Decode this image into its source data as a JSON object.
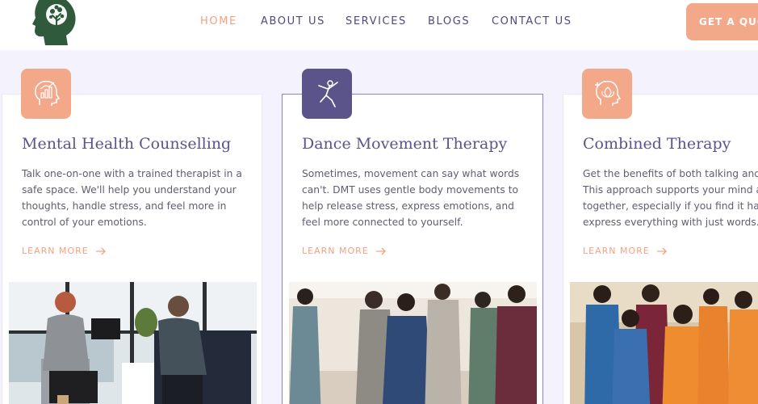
{
  "header": {
    "nav": [
      {
        "label": "HOME",
        "active": true
      },
      {
        "label": "ABOUT US",
        "active": false
      },
      {
        "label": "SERVICES",
        "active": false
      },
      {
        "label": "BLOGS",
        "active": false
      },
      {
        "label": "CONTACT US",
        "active": false
      }
    ],
    "cta_label": "GET A QUOTE"
  },
  "colors": {
    "accent_orange": "#f4a88a",
    "accent_purple": "#5b548a",
    "logo_green": "#2f5a3c",
    "page_bg": "#f4f2fd"
  },
  "cards": [
    {
      "icon": "head-chart-icon",
      "title": "Mental Health Counselling",
      "description": [
        "Talk one-on-one with a trained therapist in a",
        "safe space. We'll help you understand your",
        "thoughts, handle stress, and feel more in",
        "control of your emotions."
      ],
      "link": "LEARN MORE",
      "image": "counselling-session-photo"
    },
    {
      "icon": "dancer-icon",
      "title": "Dance Movement Therapy",
      "description": [
        "Sometimes, movement can say what words",
        "can't. DMT uses gentle body movements to",
        "help release stress, express emotions, and",
        "feel more connected to yourself."
      ],
      "link": "LEARN MORE",
      "image": "dance-group-photo"
    },
    {
      "icon": "head-lotus-icon",
      "title": "Combined Therapy",
      "description": [
        "Get the benefits of both talking and m",
        "This approach supports your mind ar",
        "together, especially if you find it hard",
        "express everything with just words."
      ],
      "link": "LEARN MORE",
      "image": "group-dance-class-photo"
    }
  ]
}
